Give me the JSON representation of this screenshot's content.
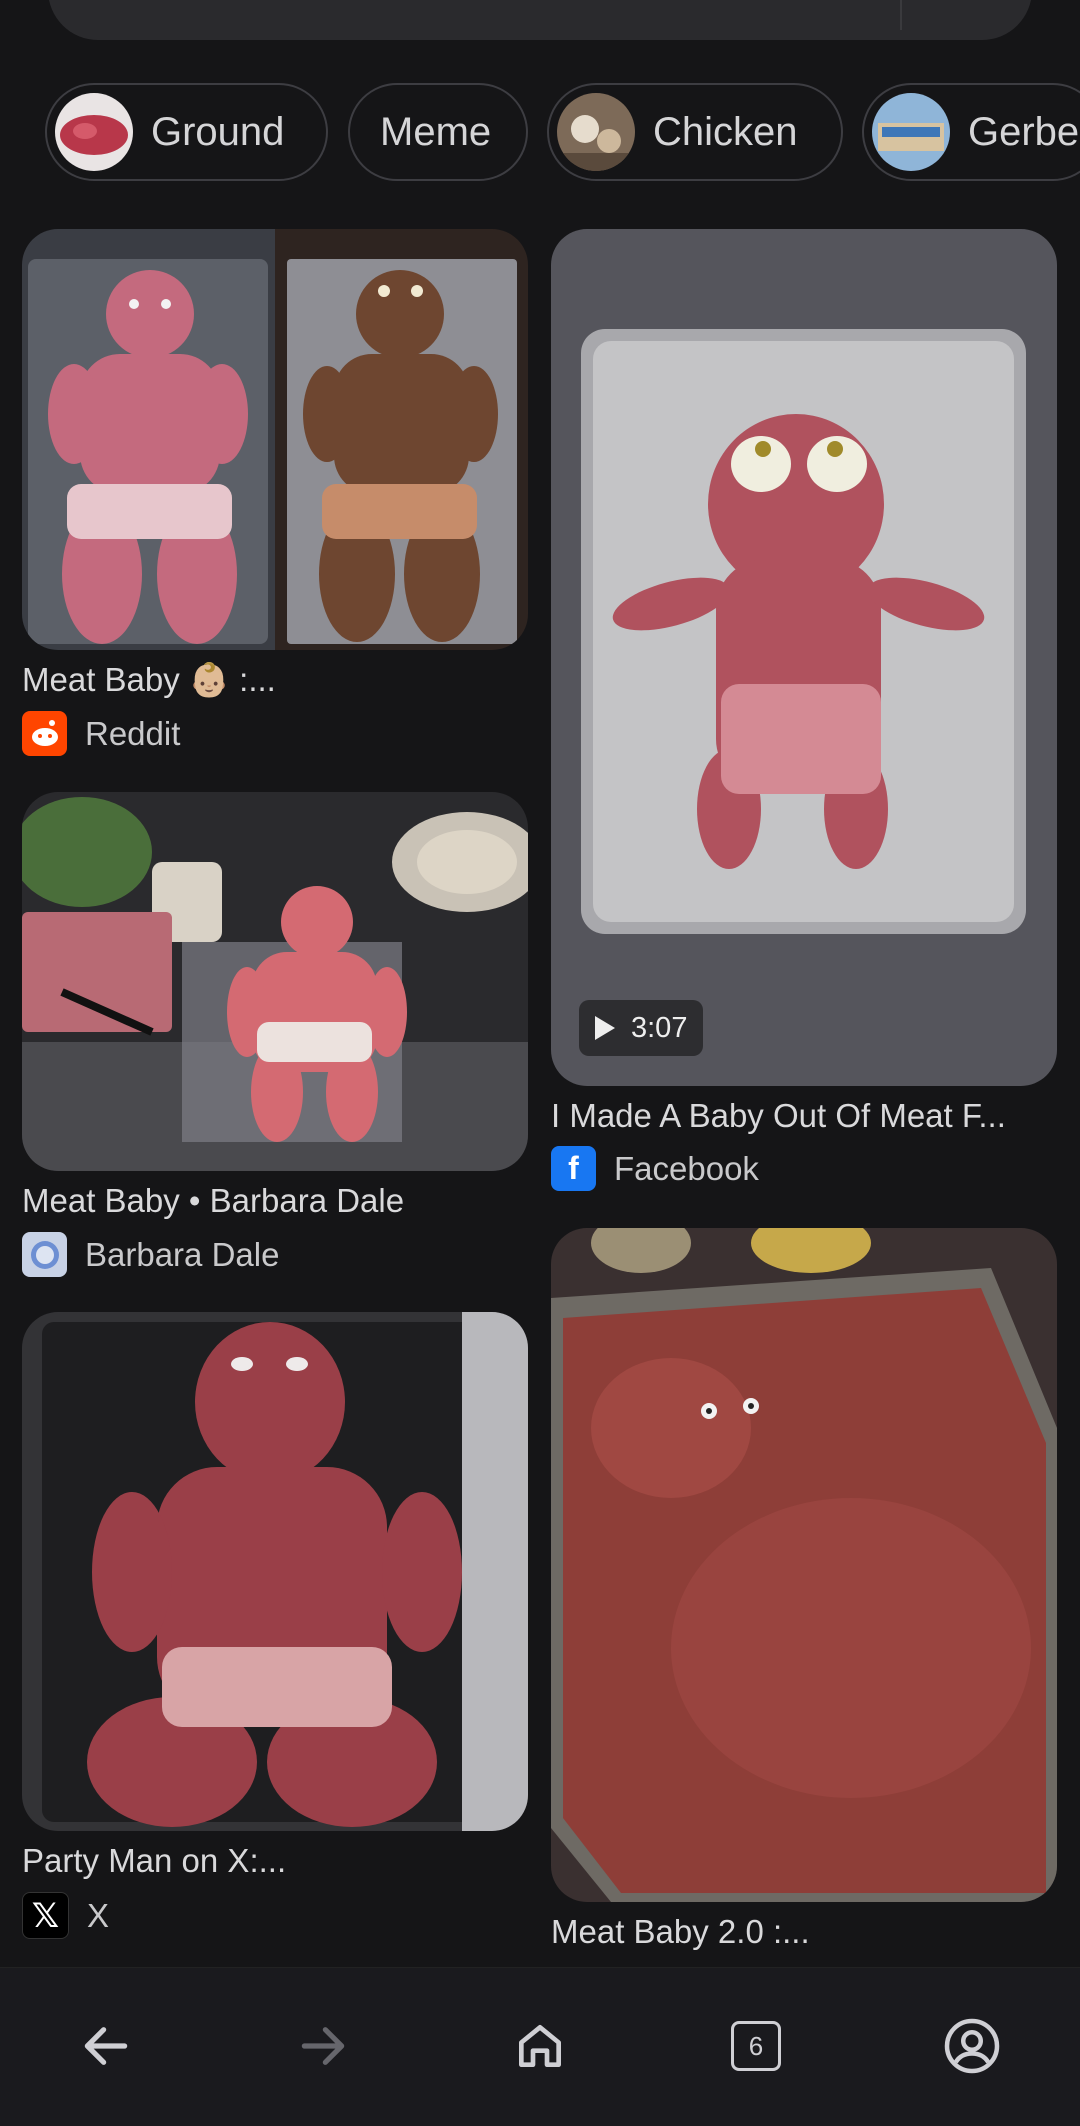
{
  "chips": [
    {
      "label": "Ground"
    },
    {
      "label": "Meme"
    },
    {
      "label": "Chicken"
    },
    {
      "label": "Gerbe"
    }
  ],
  "results": [
    {
      "title": "Meat Baby 👶🏼 :...",
      "source": "Reddit",
      "favicon_color": "#ff4500"
    },
    {
      "title": "I Made A Baby Out Of Meat F...",
      "source": "Facebook",
      "duration": "3:07",
      "favicon_color": "#1877f2"
    },
    {
      "title": "Meat Baby • Barbara Dale",
      "source": "Barbara Dale",
      "favicon_color": "#6d8fd3"
    },
    {
      "title": "Party Man on X:...",
      "source": "X",
      "favicon_color": "#000000"
    },
    {
      "title": "Meat Baby 2.0 :..."
    }
  ],
  "navbar": {
    "back_icon": "arrow-left-icon",
    "forward_icon": "arrow-right-icon",
    "home_icon": "home-icon",
    "tabs_count": "6",
    "account_icon": "account-icon"
  }
}
